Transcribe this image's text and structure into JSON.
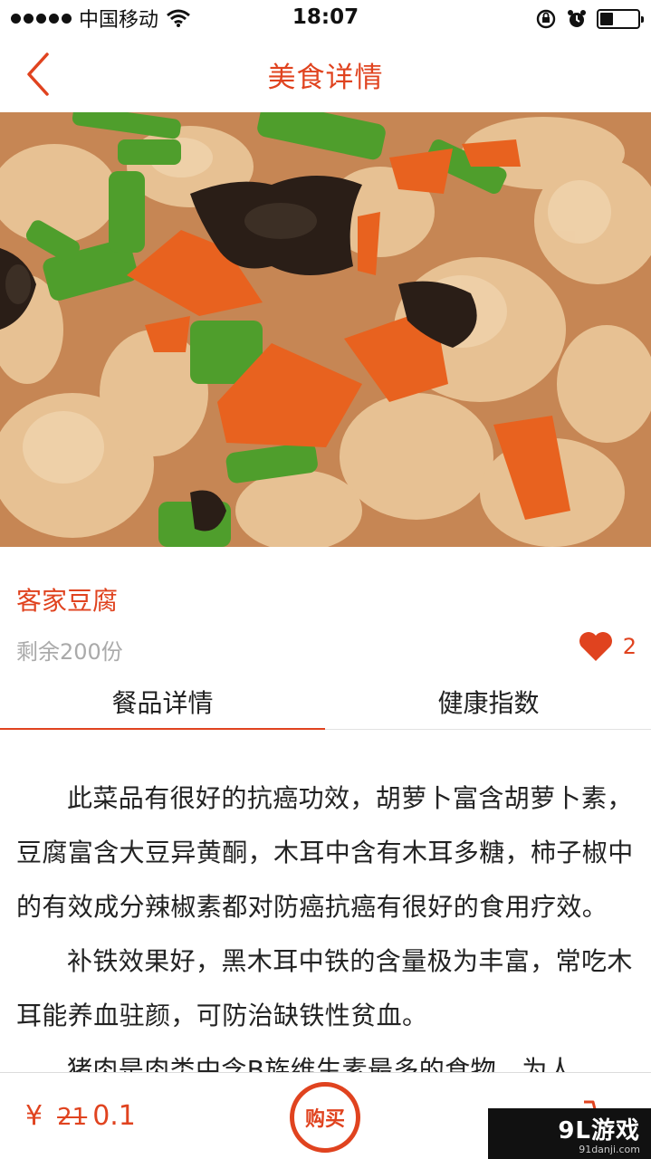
{
  "status_bar": {
    "carrier": "中国移动",
    "time": "18:07"
  },
  "navbar": {
    "title": "美食详情",
    "back_icon": "chevron-left-icon"
  },
  "banner": {
    "image": "dish-photo",
    "slide_count": 1,
    "active_slide": 1
  },
  "dish": {
    "name": "客家豆腐",
    "remaining": "剩余200份",
    "likes": "2"
  },
  "tabs": [
    {
      "label": "餐品详情",
      "active": true
    },
    {
      "label": "健康指数",
      "active": false
    }
  ],
  "content": {
    "paragraphs": [
      "此菜品有很好的抗癌功效，胡萝卜富含胡萝卜素，豆腐富含大豆异黄酮，木耳中含有木耳多糖，柿子椒中的有效成分辣椒素都对防癌抗癌有很好的食用疗效。",
      "补铁效果好，黑木耳中铁的含量极为丰富，常吃木耳能养血驻颜，可防治缺铁性贫血。",
      "猪肉是肉类中含B族维生素最多的食物，为人"
    ]
  },
  "bottom_bar": {
    "currency": "¥",
    "original_price": "21",
    "price": "0.1",
    "buy_label": "购买",
    "cart_icon": "cart-icon"
  },
  "watermark": {
    "main": "9L游戏",
    "sub": "91danji.com"
  },
  "colors": {
    "accent": "#e0431f",
    "muted": "#aaaaaa"
  }
}
